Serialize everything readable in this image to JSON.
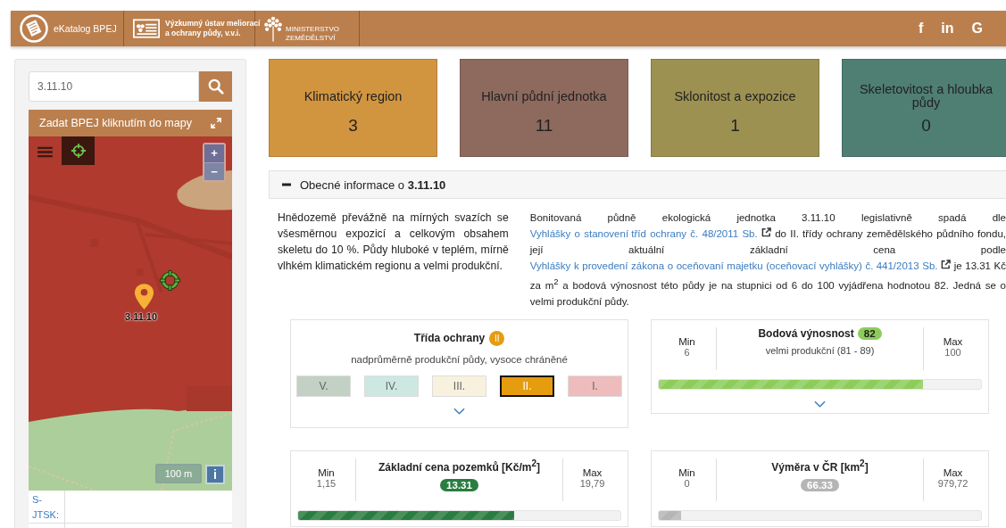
{
  "header": {
    "brand": "eKatalog BPEJ",
    "institute": [
      "Výzkumný ústav meliorací",
      "a ochrany půdy, v.v.i."
    ],
    "ministry": "MINISTERSTVO ZEMĚDĚLSTVÍ",
    "social": [
      "f",
      "in",
      "G"
    ]
  },
  "search": {
    "value": "3.11.10"
  },
  "map": {
    "title": "Zadat BPEJ kliknutím do mapy",
    "marker_label": "3.11.10",
    "scale": "100 m",
    "info": "i",
    "zoom_in": "+",
    "zoom_out": "−"
  },
  "coordinates": [
    {
      "label": "S-JTSK:"
    }
  ],
  "tiles": [
    {
      "title": "Klimatický region",
      "value": "3",
      "color": "#d19540"
    },
    {
      "title": "Hlavní půdní jednotka",
      "value": "11",
      "color": "#8e6a5e"
    },
    {
      "title": "Sklonitost a expozice",
      "value": "1",
      "color": "#9c9150"
    },
    {
      "title": "Skeletovitost a hloubka půdy",
      "value": "0",
      "color": "#4f7f72"
    }
  ],
  "section": {
    "expanded": true,
    "title": "Obecné informace o **3.11.10**",
    "description": "Hnědozemě převážně na mírných svazích se všesměrnou expozicí a celkovým obsahem skeletu do 10 %. Půdy hluboké v teplém, mírně vlhkém klimatickém regionu a velmi produkční.",
    "legal": [
      {
        "kind": "text",
        "text": "Bonitovaná půdně ekologická jednotka 3.11.10 legislativně spadá dle "
      },
      {
        "kind": "link",
        "text": "Vyhlášky o stanovení",
        "external": false
      },
      {
        "kind": "link",
        "text": "tříd ochrany č. 48/2011 Sb.",
        "external": true
      },
      {
        "kind": "text",
        "text": " do II. třídy ochrany zemědělského půdního fondu, její aktuální základní cena podle "
      },
      {
        "kind": "link",
        "text": "Vyhlášky k provedení zákona o oceňovaní majetku (oceňovací vyhlášky) č.",
        "external": false
      },
      {
        "kind": "link",
        "text": "441/2013 Sb.",
        "external": true
      },
      {
        "kind": "text",
        "text": " je 13.31 Kč za m$^{2}$ a bodová výnosnost této půdy je na stupnici od 6 do 100 vyjádřena hodnotou 82. Jedná se o velmi produkční půdy."
      }
    ]
  },
  "protection": {
    "title": "Třída ochrany",
    "badge": "II",
    "description": "nadprůměrně produkční půdy, vysoce chráněné",
    "classes": [
      {
        "label": "V.",
        "color": "#c3d0c4",
        "selected": false
      },
      {
        "label": "IV.",
        "color": "#cde8e1",
        "selected": false
      },
      {
        "label": "III.",
        "color": "#f8f1de",
        "selected": false
      },
      {
        "label": "II.",
        "color": "#e69c0f",
        "selected": true
      },
      {
        "label": "I.",
        "color": "#eebcbc",
        "selected": false
      }
    ]
  },
  "ranges": [
    {
      "title": "Bodová výnosnost",
      "badge": "82",
      "subtitle": "velmi produkční (81 - 89)",
      "min_label": "Min",
      "min": "6",
      "max_label": "Max",
      "max": "100",
      "level": 0.82,
      "color": "#8dcc5a",
      "expandable": true
    },
    {
      "title": "Základní cena pozemků [Kč/m$^{2}$]",
      "badge": "13.31",
      "min_label": "Min",
      "min": "1,15",
      "max_label": "Max",
      "max": "19,79",
      "level": 0.67,
      "color": "#2a7d41",
      "expandable": false
    },
    {
      "title": "Výměra v ČR [km$^{2}$]",
      "badge": "66.33",
      "min_label": "Min",
      "min": "0",
      "max_label": "Max",
      "max": "979,72",
      "level": 0.07,
      "color": "#b5b5b5",
      "expandable": false
    }
  ]
}
